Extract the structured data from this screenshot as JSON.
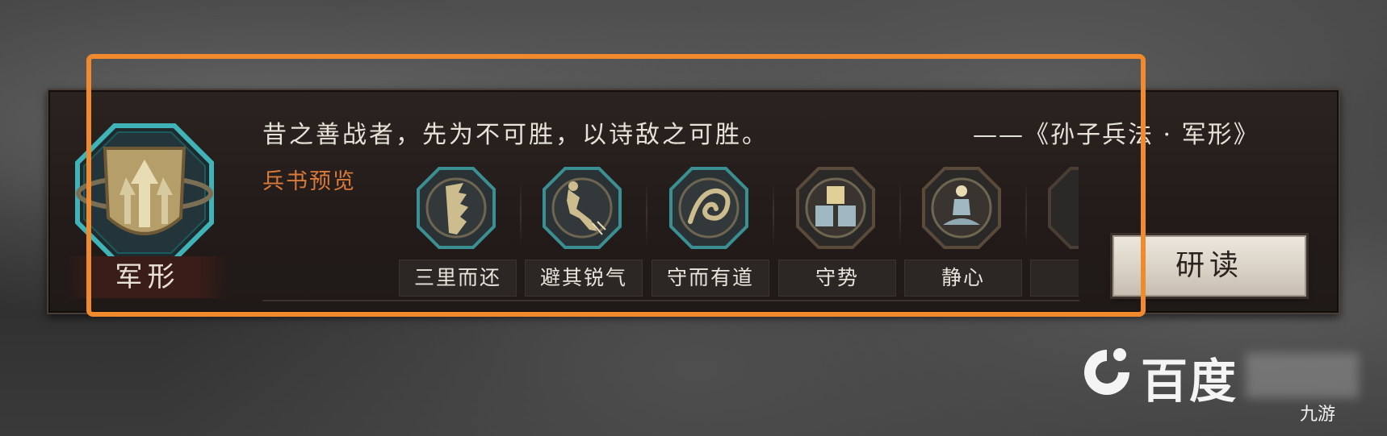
{
  "emblem": {
    "label": "军形",
    "icon": "shield-arrow-emblem-icon"
  },
  "quote": {
    "text": "昔之善战者，先为不可胜，以诗敌之可胜。",
    "source": "——《孙子兵法 · 军形》"
  },
  "preview": {
    "label": "兵书预览",
    "books": [
      {
        "label": "三里而还",
        "icon": "jagged-blade-icon"
      },
      {
        "label": "避其锐气",
        "icon": "dodging-figure-icon"
      },
      {
        "label": "守而有道",
        "icon": "swirl-sigil-icon"
      },
      {
        "label": "守势",
        "icon": "stacked-shields-icon"
      },
      {
        "label": "静心",
        "icon": "meditating-figure-icon"
      },
      {
        "label": "",
        "icon": "partial-book-icon"
      }
    ]
  },
  "study_button": {
    "label": "研读"
  },
  "watermark": {
    "text": "百度",
    "small": "九游"
  },
  "colors": {
    "highlight": "#f08a2c",
    "preview_label": "#d97a3a"
  }
}
